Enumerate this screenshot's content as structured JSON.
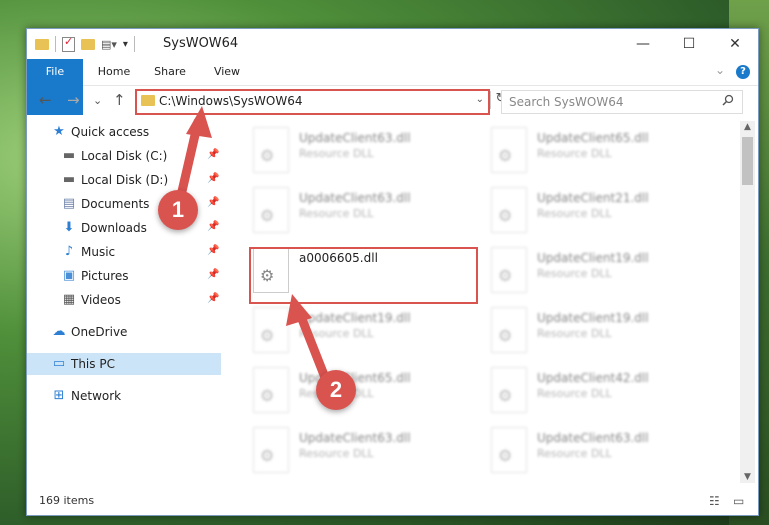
{
  "window": {
    "title": "SysWOW64"
  },
  "title_buttons": {
    "minimize": "—",
    "maximize": "☐",
    "close": "✕"
  },
  "ribbon": {
    "tabs": [
      "File",
      "Home",
      "Share",
      "View"
    ],
    "expand": "⌄",
    "help": "?"
  },
  "nav": {
    "back": "←",
    "forward": "→",
    "recent": "⌄",
    "up": "↑"
  },
  "address": {
    "path": "C:\\Windows\\SysWOW64",
    "dropdown": "⌄",
    "refresh": "↻"
  },
  "search": {
    "placeholder": "Search SysWOW64",
    "icon": "search-icon"
  },
  "sidebar": {
    "items": [
      {
        "label": "Quick access",
        "icon": "star-icon",
        "glyph": "★",
        "color": "#2d7fd3"
      },
      {
        "label": "Local Disk (C:)",
        "icon": "drive-icon",
        "glyph": "▬",
        "color": "#666",
        "pin": "📌"
      },
      {
        "label": "Local Disk (D:)",
        "icon": "drive-icon",
        "glyph": "▬",
        "color": "#666",
        "pin": "📌"
      },
      {
        "label": "Documents",
        "icon": "document-icon",
        "glyph": "▤",
        "color": "#6a7fa8",
        "pin": "📌"
      },
      {
        "label": "Downloads",
        "icon": "download-icon",
        "glyph": "⬇",
        "color": "#2d7fd3",
        "pin": "📌"
      },
      {
        "label": "Music",
        "icon": "music-icon",
        "glyph": "♪",
        "color": "#2d7fd3",
        "pin": "📌"
      },
      {
        "label": "Pictures",
        "icon": "pictures-icon",
        "glyph": "▣",
        "color": "#4a90d9",
        "pin": "📌"
      },
      {
        "label": "Videos",
        "icon": "video-icon",
        "glyph": "▦",
        "color": "#555",
        "pin": "📌"
      },
      {
        "label": "OneDrive",
        "icon": "cloud-icon",
        "glyph": "☁",
        "color": "#2d7fd3"
      },
      {
        "label": "This PC",
        "icon": "computer-icon",
        "glyph": "▭",
        "color": "#2d7fd3"
      },
      {
        "label": "Network",
        "icon": "network-icon",
        "glyph": "⊞",
        "color": "#2d7fd3"
      }
    ]
  },
  "files": [
    {
      "name": "UpdateClient63.dll",
      "type": "Resource DLL"
    },
    {
      "name": "UpdateClient65.dll",
      "type": "Resource DLL"
    },
    {
      "name": "UpdateClient63.dll",
      "type": "Resource DLL"
    },
    {
      "name": "UpdateClient21.dll",
      "type": "Resource DLL"
    },
    {
      "name": "a0006605.dll",
      "type": ""
    },
    {
      "name": "UpdateClient19.dll",
      "type": "Resource DLL"
    },
    {
      "name": "UpdateClient19.dll",
      "type": "Resource DLL"
    },
    {
      "name": "UpdateClient19.dll",
      "type": "Resource DLL"
    },
    {
      "name": "UpdateClient65.dll",
      "type": "Resource DLL"
    },
    {
      "name": "UpdateClient42.dll",
      "type": "Resource DLL"
    },
    {
      "name": "UpdateClient63.dll",
      "type": "Resource DLL"
    },
    {
      "name": "UpdateClient63.dll",
      "type": "Resource DLL"
    }
  ],
  "status": {
    "count": "169 items"
  },
  "annotations": {
    "step1": "1",
    "step2": "2",
    "color": "#d9534f"
  },
  "accent": "#1979ca"
}
